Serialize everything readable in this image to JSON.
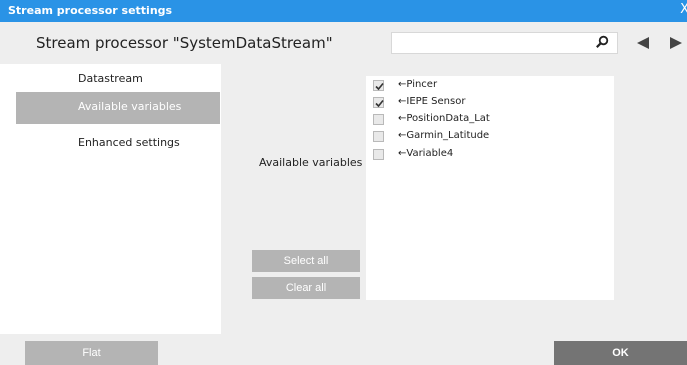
{
  "window": {
    "title": "Stream processor settings",
    "close_glyph": "X"
  },
  "header": {
    "title": "Stream processor \"SystemDataStream\"",
    "search_value": ""
  },
  "sidebar": {
    "items": [
      {
        "label": "Datastream",
        "active": false
      },
      {
        "label": "Available variables",
        "active": true
      },
      {
        "label": "Enhanced settings",
        "active": false
      }
    ]
  },
  "main": {
    "section_label": "Available variables",
    "select_all_label": "Select all",
    "clear_all_label": "Clear all",
    "variables": [
      {
        "label": "←Pincer",
        "checked": true,
        "selected": true
      },
      {
        "label": "←IEPE Sensor",
        "checked": true,
        "selected": false
      },
      {
        "label": "←PositionData_Lat",
        "checked": false,
        "selected": false
      },
      {
        "label": "←Garmin_Latitude",
        "checked": false,
        "selected": false
      },
      {
        "label": "←Variable4",
        "checked": false,
        "selected": false
      }
    ]
  },
  "footer": {
    "flat_label": "Flat",
    "ok_label": "OK"
  },
  "colors": {
    "titlebar": "#2a93e6",
    "selection": "#3d95ea",
    "active_tab": "#b4b4b4",
    "ok_button": "#747474"
  }
}
